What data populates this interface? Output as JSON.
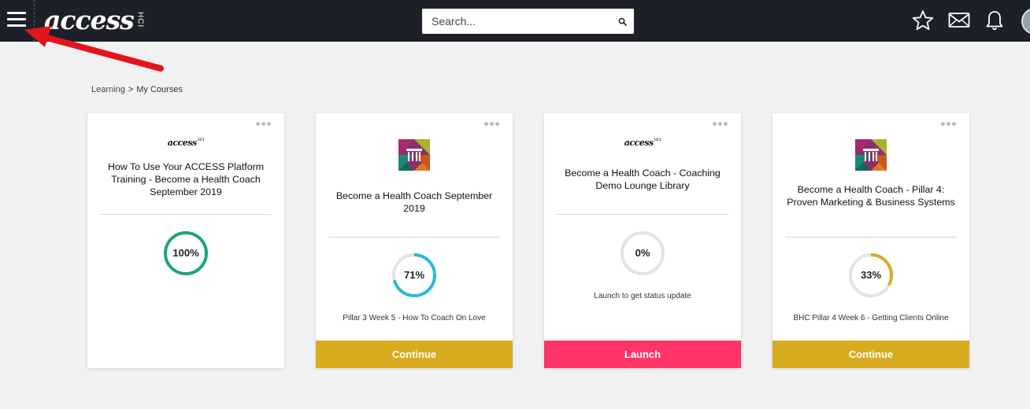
{
  "header": {
    "logo_text": "access",
    "logo_sub": "HCI",
    "search_placeholder": "Search...",
    "icons": [
      "menu-icon",
      "search-icon",
      "star-icon",
      "mail-icon",
      "bell-icon",
      "avatar"
    ]
  },
  "breadcrumb": {
    "parent": "Learning",
    "separator": ">",
    "current": "My Courses"
  },
  "colors": {
    "topbar": "#1d2029",
    "green": "#1aa776",
    "cyan": "#2bbad6",
    "gold": "#d9ab1f",
    "pink": "#ff3466",
    "track": "#e3e3e3"
  },
  "courses": [
    {
      "logo": "access-logo",
      "logo_text": "access",
      "logo_sub": "HCI",
      "title": "How To Use Your ACCESS Platform Training - Become a Health Coach September 2019",
      "progress": 100,
      "progress_label": "100%",
      "status": "",
      "button": ""
    },
    {
      "logo": "pillar-logo",
      "title": "Become a Health Coach September 2019",
      "progress": 71,
      "progress_label": "71%",
      "status": "Pillar 3 Week 5 - How To Coach On Love",
      "button": "Continue"
    },
    {
      "logo": "access-logo",
      "logo_text": "access",
      "logo_sub": "HCI",
      "title": "Become a Health Coach - Coaching Demo Lounge Library",
      "progress": 0,
      "progress_label": "0%",
      "status": "Launch to get status update",
      "button": "Launch"
    },
    {
      "logo": "pillar-logo",
      "title": "Become a Health Coach - Pillar 4: Proven Marketing & Business Systems",
      "progress": 33,
      "progress_label": "33%",
      "status": "BHC Pillar 4 Week 6 - Getting Clients Online",
      "button": "Continue"
    }
  ]
}
